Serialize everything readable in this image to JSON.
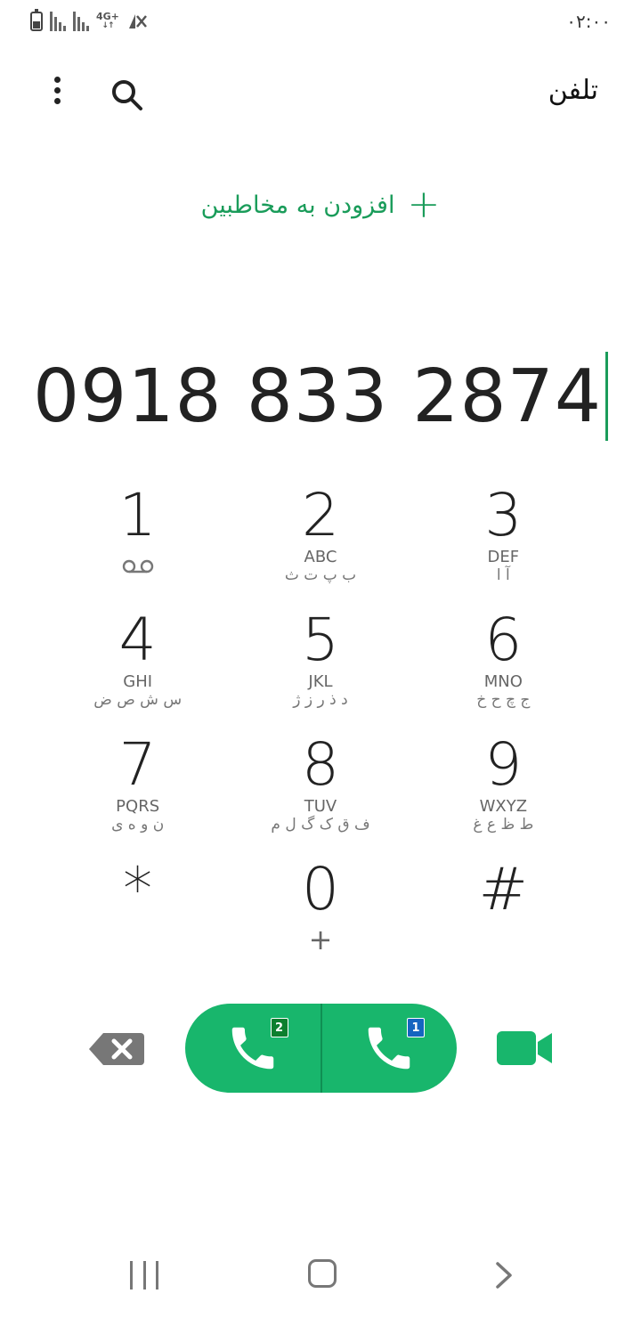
{
  "status_bar": {
    "clock": "۰۲:۰۰",
    "network": "4G+"
  },
  "header": {
    "title": "تلفن"
  },
  "add_contact": {
    "label": "افزودن به مخاطبین"
  },
  "dialed_number": "0918 833 2874",
  "keypad": {
    "keys": [
      {
        "digit": "1",
        "latin": "",
        "persian": ""
      },
      {
        "digit": "2",
        "latin": "ABC",
        "persian": "ب پ ت ث"
      },
      {
        "digit": "3",
        "latin": "DEF",
        "persian": "آ ا"
      },
      {
        "digit": "4",
        "latin": "GHI",
        "persian": "س ش ص ض"
      },
      {
        "digit": "5",
        "latin": "JKL",
        "persian": "د ذ ر ز ژ"
      },
      {
        "digit": "6",
        "latin": "MNO",
        "persian": "ج چ ح خ"
      },
      {
        "digit": "7",
        "latin": "PQRS",
        "persian": "ن و ه ی"
      },
      {
        "digit": "8",
        "latin": "TUV",
        "persian": "ف ق ک گ ل م"
      },
      {
        "digit": "9",
        "latin": "WXYZ",
        "persian": "ط ظ ع غ"
      },
      {
        "digit": "*",
        "latin": "",
        "persian": ""
      },
      {
        "digit": "0",
        "latin": "",
        "persian": ""
      },
      {
        "digit": "#",
        "latin": "",
        "persian": ""
      }
    ],
    "zero_sub": "+"
  },
  "call": {
    "sim2_label": "2",
    "sim1_label": "1"
  },
  "colors": {
    "accent": "#1a9c5a",
    "call_green": "#18b66c",
    "sim1": "#1565c0",
    "sim2": "#0c7f2e"
  },
  "icons": [
    "more-vert-icon",
    "search-icon",
    "plus-icon",
    "voicemail-icon",
    "backspace-icon",
    "phone-icon",
    "video-call-icon",
    "recent-apps-icon",
    "home-icon",
    "back-icon"
  ]
}
